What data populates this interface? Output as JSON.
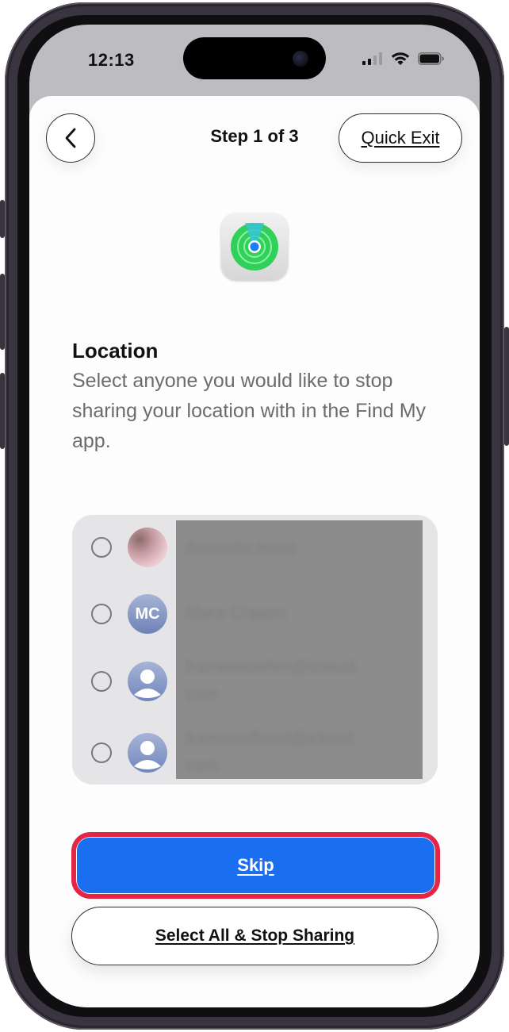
{
  "status_bar": {
    "time": "12:13",
    "icons": [
      "cellular-signal-icon",
      "wifi-icon",
      "battery-icon"
    ]
  },
  "header": {
    "back_icon": "chevron-left-icon",
    "step": "Step 1 of 3",
    "quick_exit_label": "Quick Exit"
  },
  "app_icon": "find-my-icon",
  "section": {
    "title": "Location",
    "description": "Select anyone you would like to stop sharing your location with in the Find My app."
  },
  "contacts": [
    {
      "avatar_type": "photo",
      "initials": "",
      "name_line1": "Amanda Haas",
      "name_line2": ""
    },
    {
      "avatar_type": "initials",
      "initials": "MC",
      "name_line1": "Mara Craven",
      "name_line2": ""
    },
    {
      "avatar_type": "person",
      "initials": "",
      "name_line1": "frameworkhm@icloud.",
      "name_line2": "com"
    },
    {
      "avatar_type": "person",
      "initials": "",
      "name_line1": "framesuffixed@icloud.",
      "name_line2": "com"
    }
  ],
  "actions": {
    "skip_label": "Skip",
    "select_all_label": "Select All & Stop Sharing"
  },
  "colors": {
    "accent": "#1a6ff0",
    "highlight": "#e52543",
    "find_my_green": "#34c759"
  }
}
